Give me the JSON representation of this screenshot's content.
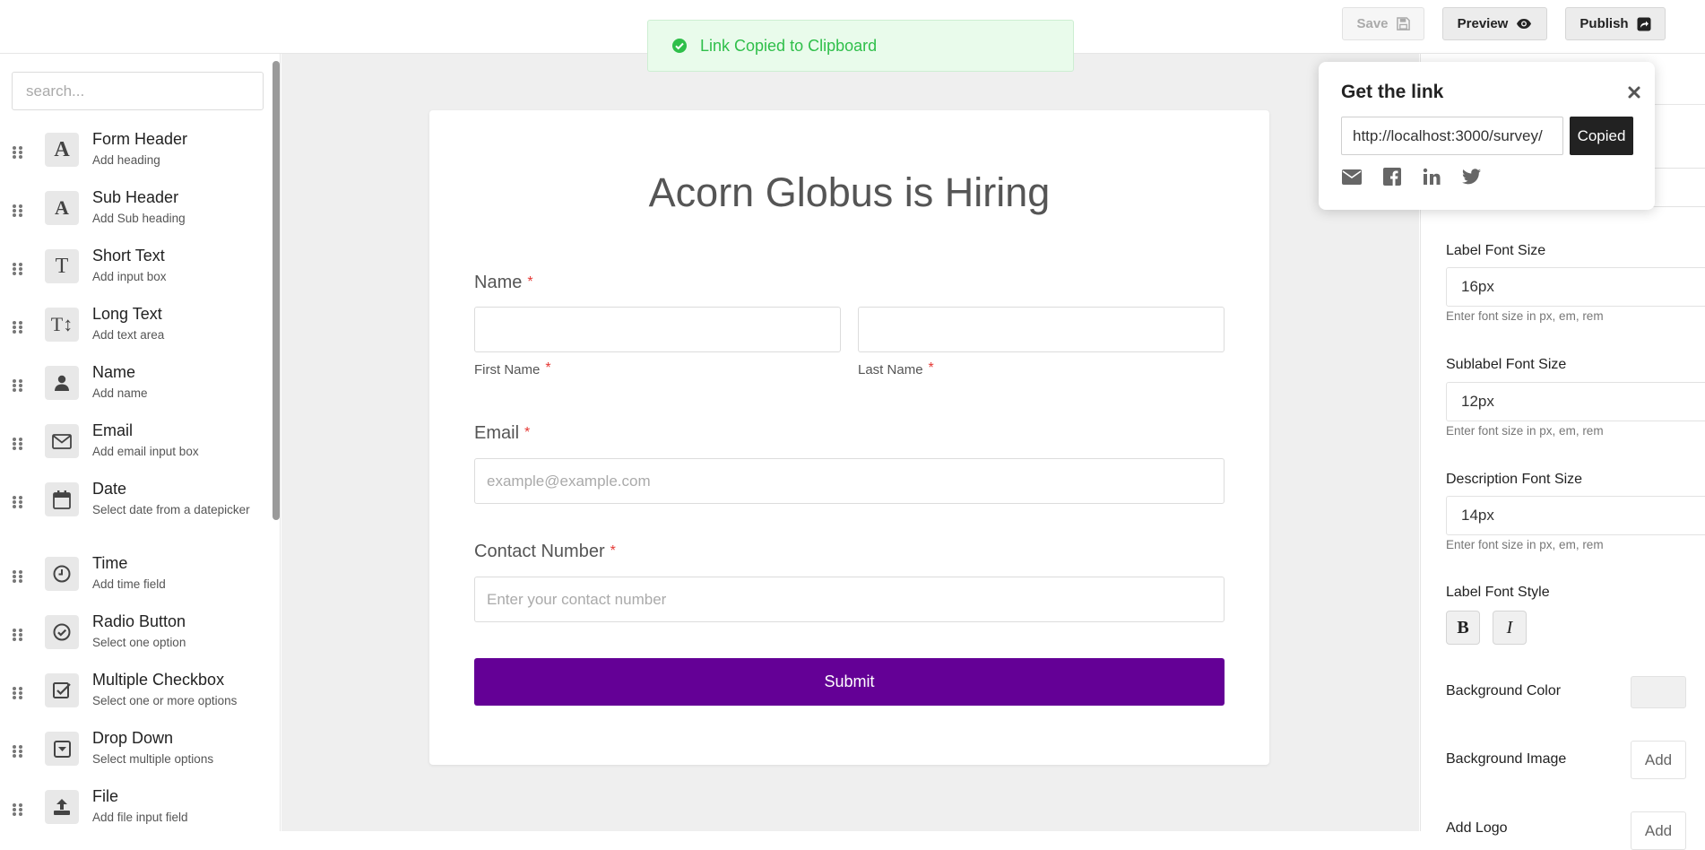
{
  "header": {
    "save_label": "Save",
    "preview_label": "Preview",
    "publish_label": "Publish"
  },
  "toast": {
    "message": "Link Copied to Clipboard",
    "color": "#2fbf4a"
  },
  "sidebar": {
    "search_placeholder": "search...",
    "items": [
      {
        "title": "Form Header",
        "subtitle": "Add heading",
        "icon": "heading-a-icon"
      },
      {
        "title": "Sub Header",
        "subtitle": "Add Sub heading",
        "icon": "subheading-a-icon"
      },
      {
        "title": "Short Text",
        "subtitle": "Add input box",
        "icon": "text-t-icon"
      },
      {
        "title": "Long Text",
        "subtitle": "Add text area",
        "icon": "text-height-icon"
      },
      {
        "title": "Name",
        "subtitle": "Add name",
        "icon": "user-icon"
      },
      {
        "title": "Email",
        "subtitle": "Add email input box",
        "icon": "envelope-icon"
      },
      {
        "title": "Date",
        "subtitle": "Select date from a datepicker",
        "icon": "calendar-icon"
      },
      {
        "title": "Time",
        "subtitle": "Add time field",
        "icon": "clock-icon"
      },
      {
        "title": "Radio Button",
        "subtitle": "Select one option",
        "icon": "check-circle-icon"
      },
      {
        "title": "Multiple Checkbox",
        "subtitle": "Select one or more options",
        "icon": "check-square-icon"
      },
      {
        "title": "Drop Down",
        "subtitle": "Select multiple options",
        "icon": "caret-square-icon"
      },
      {
        "title": "File",
        "subtitle": "Add file input field",
        "icon": "upload-icon"
      }
    ]
  },
  "form": {
    "title": "Acorn Globus is Hiring",
    "required_mark": "*",
    "name_label": "Name",
    "first_name_label": "First Name",
    "last_name_label": "Last Name",
    "email_label": "Email",
    "email_placeholder": "example@example.com",
    "contact_label": "Contact Number",
    "contact_placeholder": "Enter your contact number",
    "submit_label": "Submit",
    "submit_color": "#640096"
  },
  "right_panel": {
    "label_font_size_label": "Label Font Size",
    "label_font_size_value": "16px",
    "sublabel_font_size_label": "Sublabel Font Size",
    "sublabel_font_size_value": "12px",
    "description_font_size_label": "Description Font Size",
    "description_font_size_value": "14px",
    "font_size_help": "Enter font size in px, em, rem",
    "label_font_style_label": "Label Font Style",
    "bold_label": "B",
    "italic_label": "I",
    "background_color_label": "Background Color",
    "background_image_label": "Background Image",
    "add_label": "Add",
    "add_logo_label": "Add Logo"
  },
  "popover": {
    "title": "Get the link",
    "url": "http://localhost:3000/survey/",
    "copied_label": "Copied",
    "share_icons": [
      "email-icon",
      "facebook-icon",
      "linkedin-icon",
      "twitter-icon"
    ]
  }
}
